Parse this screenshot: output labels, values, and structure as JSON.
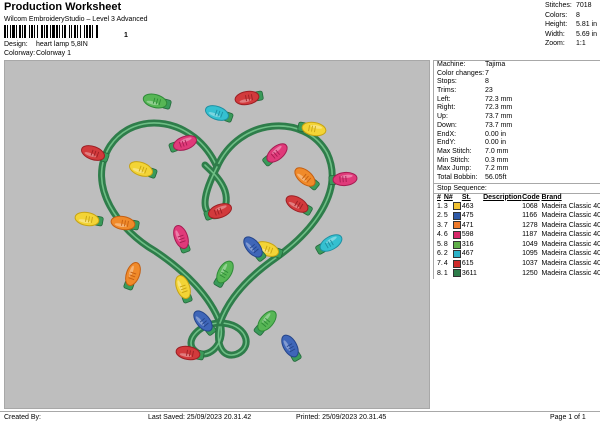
{
  "header": {
    "title": "Production Worksheet",
    "subtitle": "Wilcom EmbroideryStudio – Level 3 Advanced",
    "barcode_text": "1",
    "design_label": "Design:",
    "design_value": "heart lamp 5,8IN",
    "colorway_label": "Colorway:",
    "colorway_value": "Colorway 1"
  },
  "stats": [
    {
      "label": "Stitches:",
      "value": "7018"
    },
    {
      "label": "Colors:",
      "value": "8"
    },
    {
      "label": "Height:",
      "value": "5.81 in"
    },
    {
      "label": "Width:",
      "value": "5.69 in"
    },
    {
      "label": "Zoom:",
      "value": "1:1"
    }
  ],
  "info": [
    {
      "label": "Machine:",
      "value": "Tajima"
    },
    {
      "label": "Color changes:",
      "value": "7"
    },
    {
      "label": "Stops:",
      "value": "8"
    },
    {
      "label": "Trims:",
      "value": "23"
    },
    {
      "label": "Left:",
      "value": "72.3 mm"
    },
    {
      "label": "Right:",
      "value": "72.3 mm"
    },
    {
      "label": "Up:",
      "value": "73.7 mm"
    },
    {
      "label": "Down:",
      "value": "73.7 mm"
    },
    {
      "label": "EndX:",
      "value": "0.00 in"
    },
    {
      "label": "EndY:",
      "value": "0.00 in"
    },
    {
      "label": "Max Stitch:",
      "value": "7.0 mm"
    },
    {
      "label": "Min Stitch:",
      "value": "0.3 mm"
    },
    {
      "label": "Max Jump:",
      "value": "7.2 mm"
    },
    {
      "label": "Total Bobbin:",
      "value": "56.05ft"
    }
  ],
  "sequence": {
    "title": "Stop Sequence:",
    "columns": [
      "#",
      "N#",
      "",
      "St.",
      "Description",
      "Code",
      "Brand"
    ],
    "rows": [
      {
        "num": "1.",
        "n": "3",
        "color": "#f2c232",
        "st": "463",
        "desc": "",
        "code": "1068",
        "brand": "Madeira Classic 40"
      },
      {
        "num": "2.",
        "n": "5",
        "color": "#2f5aa8",
        "st": "475",
        "desc": "",
        "code": "1166",
        "brand": "Madeira Classic 40"
      },
      {
        "num": "3.",
        "n": "7",
        "color": "#ee7a2a",
        "st": "471",
        "desc": "",
        "code": "1278",
        "brand": "Madeira Classic 40"
      },
      {
        "num": "4.",
        "n": "6",
        "color": "#d8286a",
        "st": "598",
        "desc": "",
        "code": "1187",
        "brand": "Madeira Classic 40"
      },
      {
        "num": "5.",
        "n": "8",
        "color": "#5fae49",
        "st": "316",
        "desc": "",
        "code": "1049",
        "brand": "Madeira Classic 40"
      },
      {
        "num": "6.",
        "n": "2",
        "color": "#2bb2c8",
        "st": "467",
        "desc": "",
        "code": "1095",
        "brand": "Madeira Classic 40"
      },
      {
        "num": "7.",
        "n": "4",
        "color": "#cf2a2a",
        "st": "615",
        "desc": "",
        "code": "1037",
        "brand": "Madeira Classic 40"
      },
      {
        "num": "8.",
        "n": "1",
        "color": "#2e7d4a",
        "st": "3611",
        "desc": "",
        "code": "1250",
        "brand": "Madeira Classic 40"
      }
    ]
  },
  "footer": {
    "created_by": "Created By:",
    "last_saved": "Last Saved: 25/09/2023 20.31.42",
    "printed": "Printed: 25/09/2023 20.31.45",
    "page": "Page 1 of 1"
  },
  "design_preview": {
    "wire_color": "#2e7d4a",
    "wire_highlight": "#6fbf86",
    "bulbs": [
      {
        "color": "red"
      },
      {
        "color": "green"
      },
      {
        "color": "cyan"
      },
      {
        "color": "pink"
      },
      {
        "color": "red"
      },
      {
        "color": "yellow"
      },
      {
        "color": "pink"
      },
      {
        "color": "yellow"
      },
      {
        "color": "red"
      },
      {
        "color": "orange"
      },
      {
        "color": "pink"
      },
      {
        "color": "yellow"
      },
      {
        "color": "red"
      },
      {
        "color": "orange"
      },
      {
        "color": "cyan"
      },
      {
        "color": "yellow"
      },
      {
        "color": "pink"
      },
      {
        "color": "blue"
      },
      {
        "color": "orange"
      },
      {
        "color": "green"
      },
      {
        "color": "yellow"
      },
      {
        "color": "blue"
      },
      {
        "color": "green"
      },
      {
        "color": "red"
      },
      {
        "color": "blue"
      }
    ]
  }
}
